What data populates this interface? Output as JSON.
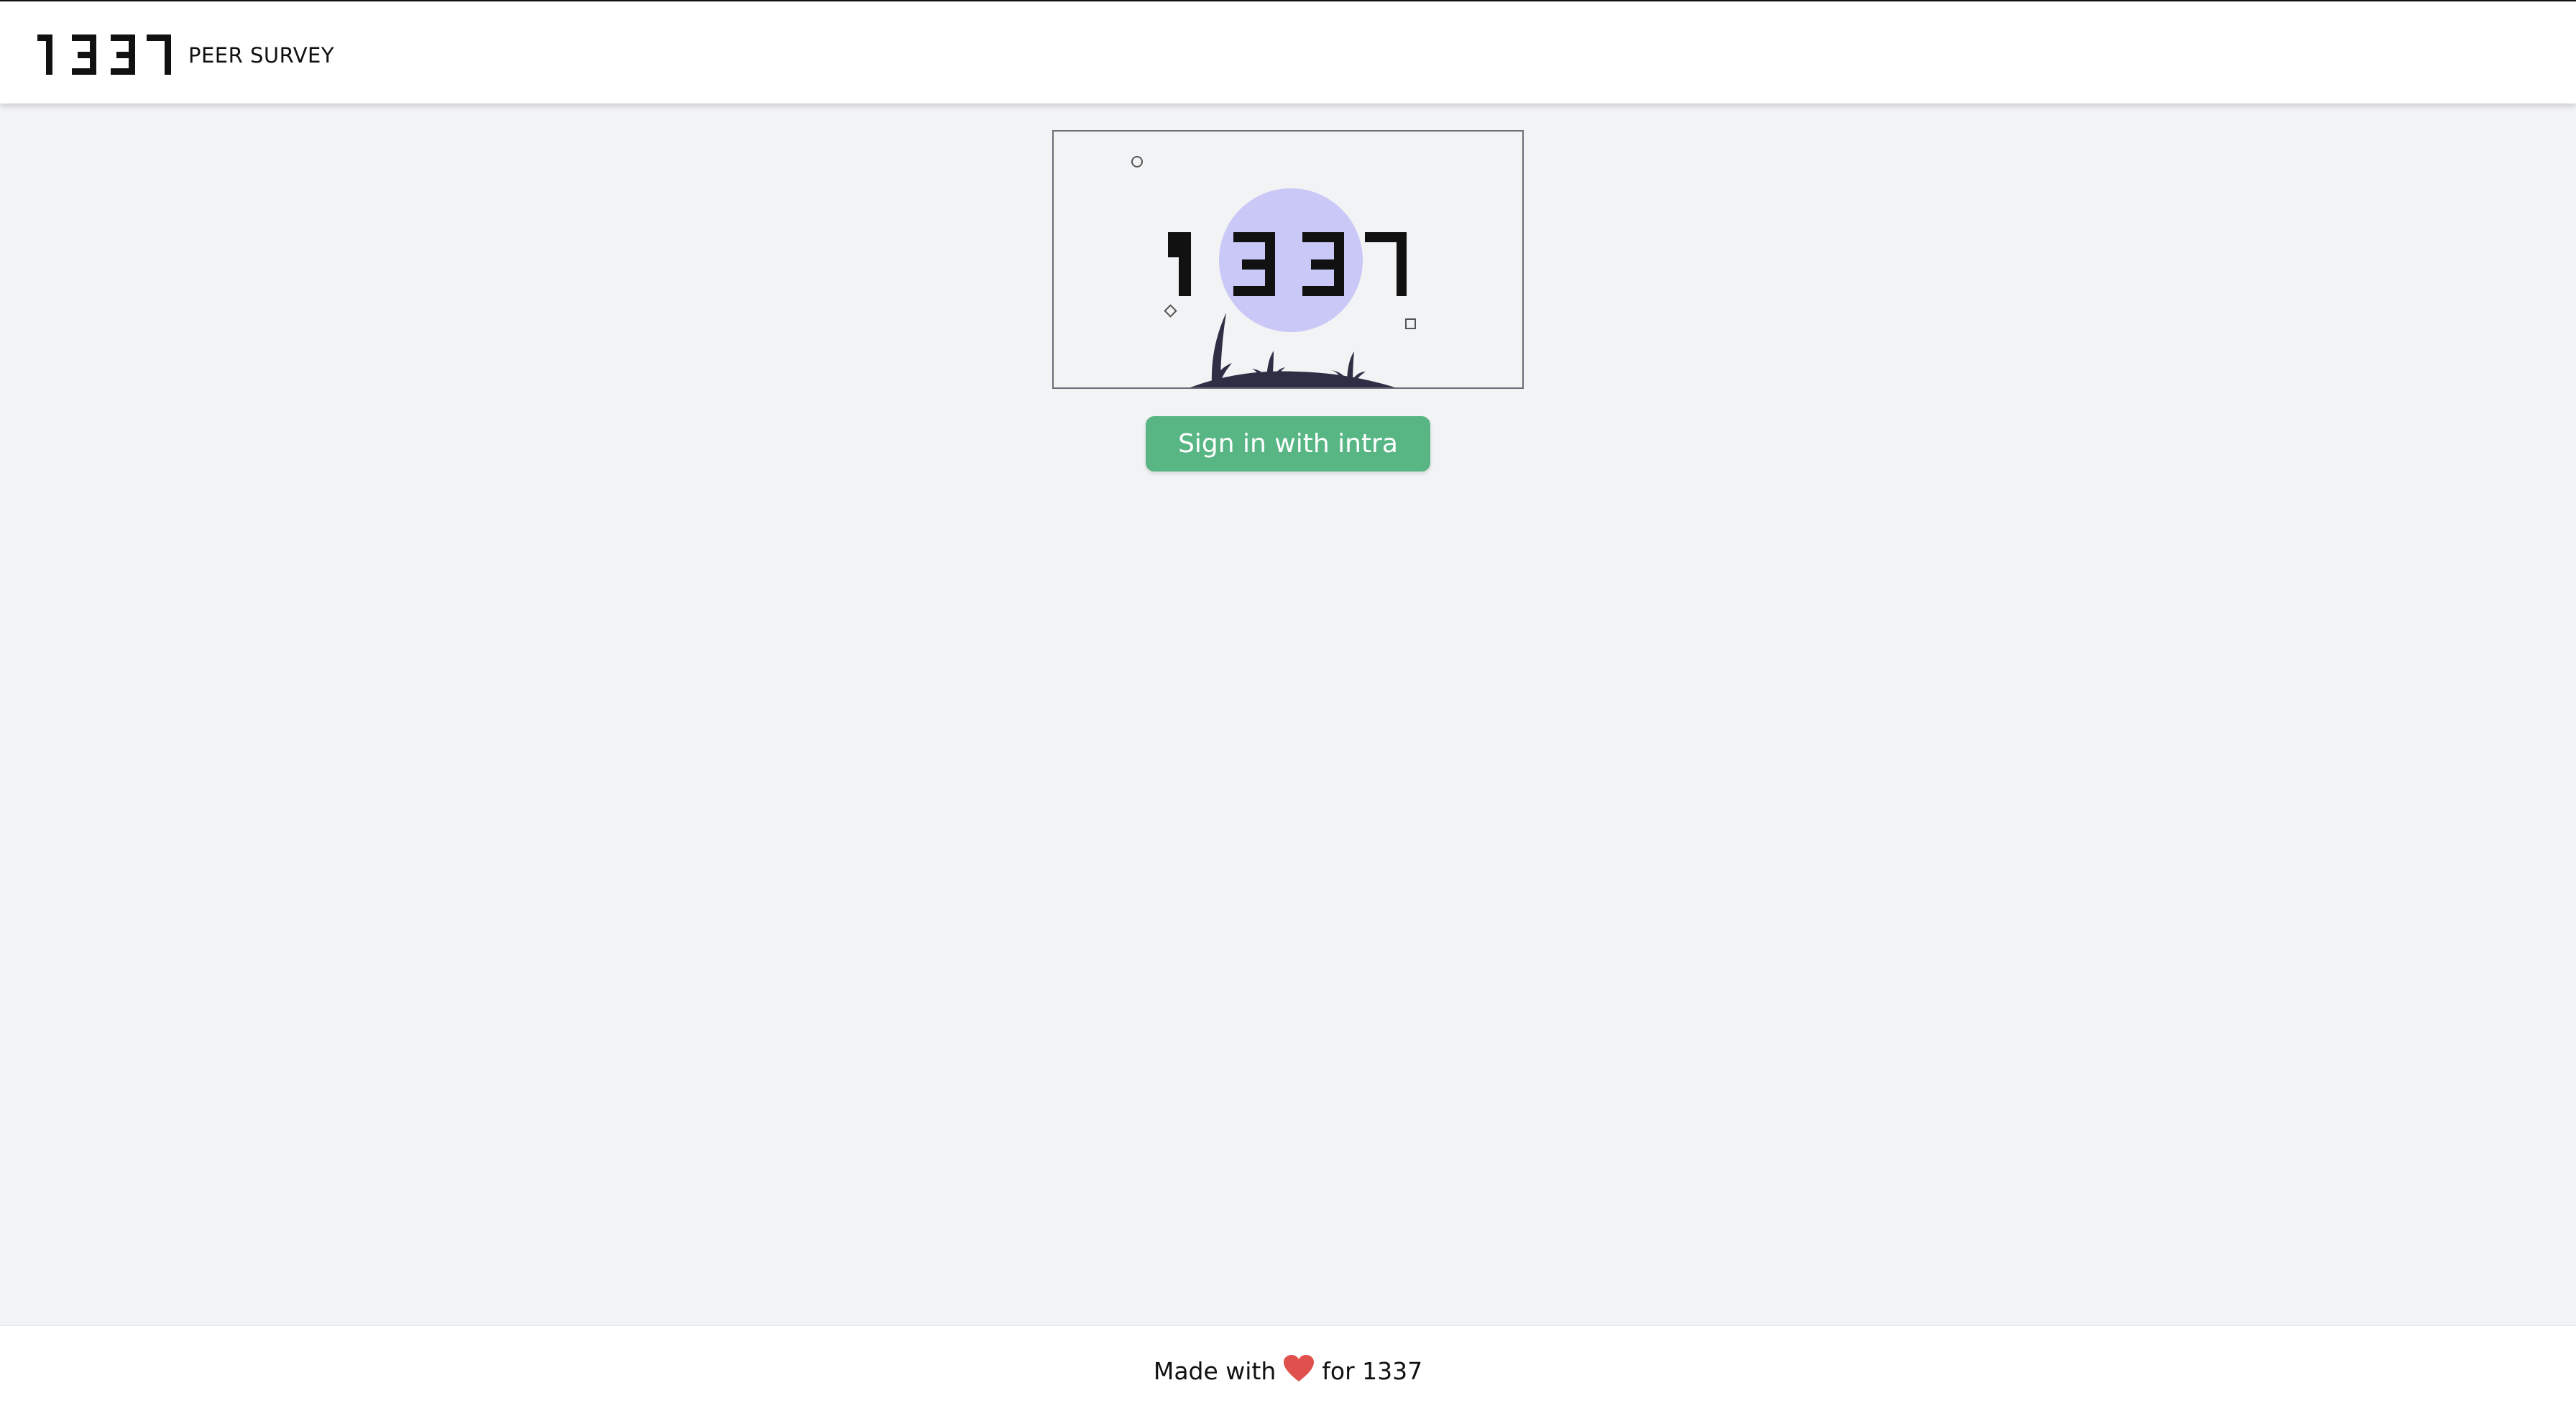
{
  "header": {
    "logo_text": "1337",
    "app_name": "PEER SURVEY"
  },
  "hero": {
    "logo_text": "1337",
    "icons": [
      "circle-outline-icon",
      "diamond-outline-icon",
      "square-outline-icon",
      "grass-illustration-icon"
    ]
  },
  "signin": {
    "label": "Sign in with intra"
  },
  "footer": {
    "prefix": "Made with",
    "heart_icon": "heart-icon",
    "suffix": "for 1337"
  },
  "colors": {
    "background": "#f2f3f5",
    "button": "#58b685",
    "accent_circle": "#c9c8f6",
    "heart": "#e0514d",
    "grass": "#2f2e45"
  }
}
